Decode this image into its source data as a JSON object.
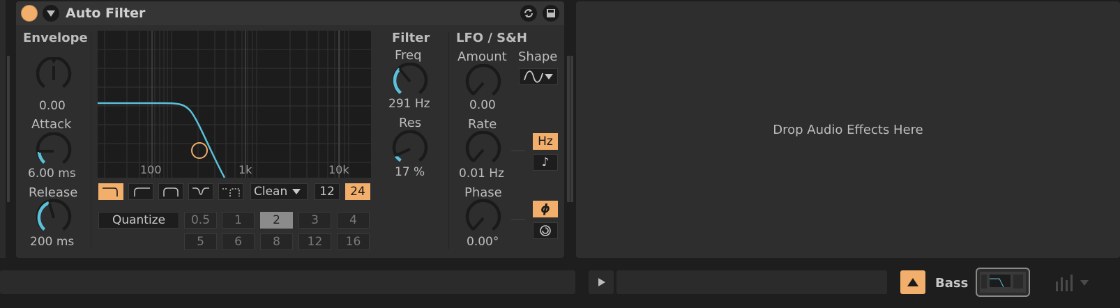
{
  "device": {
    "title": "Auto Filter",
    "accent": "#f2ae6b",
    "knob_color": "#5bc0d8",
    "envelope": {
      "heading": "Envelope",
      "amount_value": "0.00",
      "attack_label": "Attack",
      "attack_value": "6.00 ms",
      "release_label": "Release",
      "release_value": "200 ms"
    },
    "graph": {
      "freq_labels": [
        "100",
        "1k",
        "10k"
      ]
    },
    "filter_types": [
      "lowpass-icon",
      "highpass-icon",
      "bandpass-icon",
      "notch-icon",
      "morph-icon"
    ],
    "circuit": "Clean",
    "slope_options": [
      "12",
      "24"
    ],
    "slope_selected": "24",
    "quantize": {
      "label": "Quantize",
      "row1": [
        "0.5",
        "1",
        "2",
        "3",
        "4"
      ],
      "row2": [
        "5",
        "6",
        "8",
        "12",
        "16"
      ],
      "selected": "2"
    },
    "filter": {
      "heading": "Filter",
      "freq_label": "Freq",
      "freq_value": "291 Hz",
      "res_label": "Res",
      "res_value": "17 %"
    },
    "lfo": {
      "heading": "LFO / S&H",
      "amount_label": "Amount",
      "amount_value": "0.00",
      "shape_label": "Shape",
      "shape_icon": "sine-wave-icon",
      "rate_label": "Rate",
      "rate_value": "0.01 Hz",
      "hz_label": "Hz",
      "note_label": "♪",
      "phase_label": "Phase",
      "phase_value": "0.00°",
      "phase_icon": "ϕ"
    }
  },
  "drop_zone": {
    "text": "Drop Audio Effects Here"
  },
  "bottom_bar": {
    "track_name": "Bass"
  }
}
